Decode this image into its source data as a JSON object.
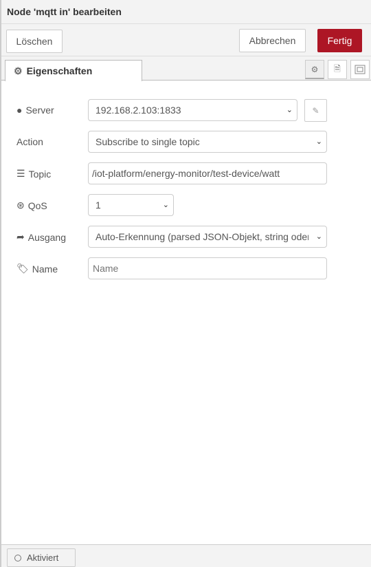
{
  "header": {
    "title": "Node 'mqtt in' bearbeiten"
  },
  "toolbar": {
    "delete_label": "Löschen",
    "cancel_label": "Abbrechen",
    "done_label": "Fertig"
  },
  "colors": {
    "primary": "#ad1625"
  },
  "tabs": [
    {
      "label": "Eigenschaften",
      "icon": "gear-icon"
    }
  ],
  "tab_icons": [
    "gear-icon",
    "document-icon",
    "frame-icon"
  ],
  "form": {
    "server": {
      "label": "Server",
      "value": "192.168.2.103:1833"
    },
    "action": {
      "label": "Action",
      "value": "Subscribe to single topic"
    },
    "topic": {
      "label": "Topic",
      "value": "/iot-platform/energy-monitor/test-device/watt"
    },
    "qos": {
      "label": "QoS",
      "value": "1"
    },
    "output": {
      "label": "Ausgang",
      "value": "Auto-Erkennung (parsed JSON-Objekt, string oder"
    },
    "name": {
      "label": "Name",
      "placeholder": "Name",
      "value": ""
    }
  },
  "footer": {
    "enabled_label": "Aktiviert"
  }
}
